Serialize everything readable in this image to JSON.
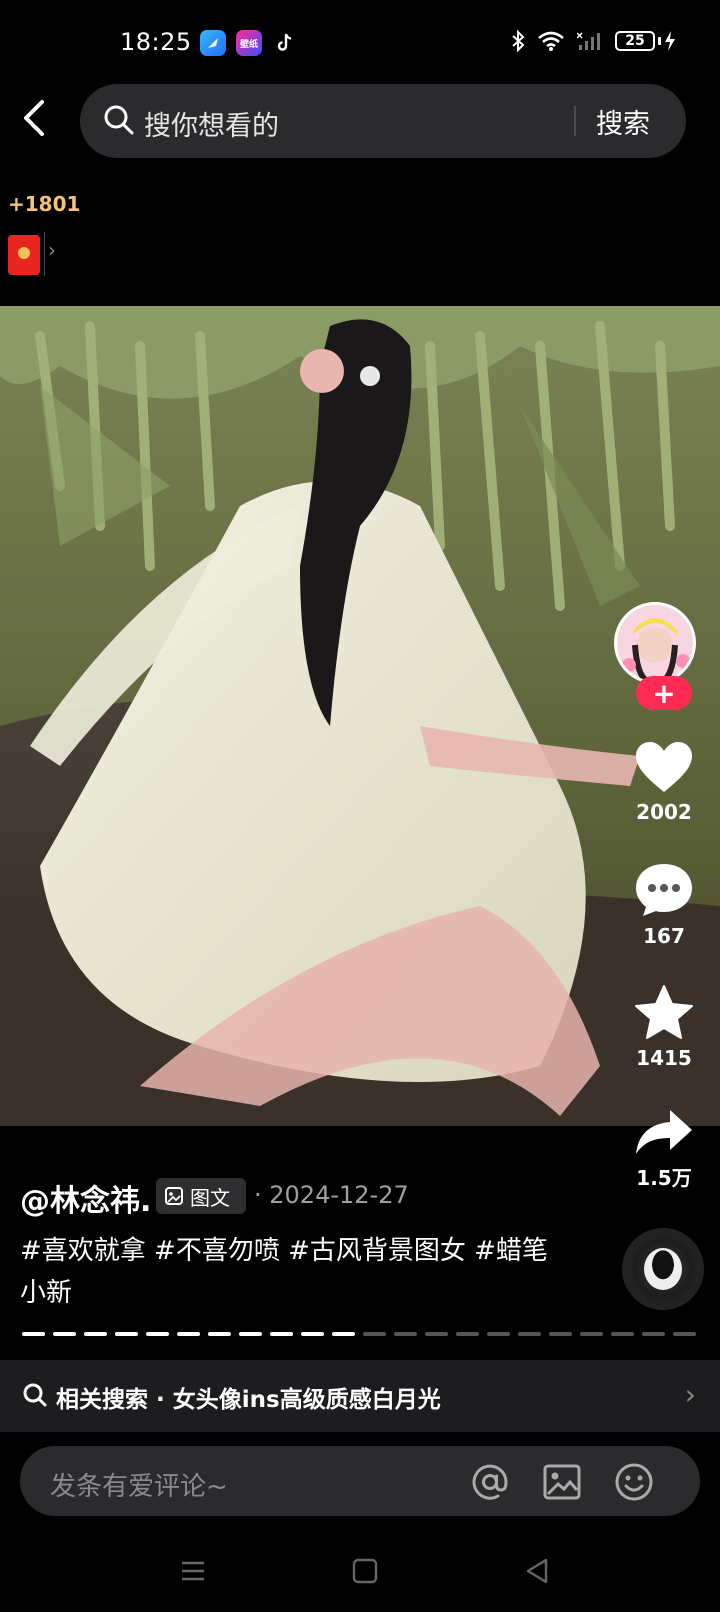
{
  "status_bar": {
    "time": "18:25",
    "app_icons": [
      "browser-app-icon",
      "wallpaper-app-icon",
      "tiktok-app-icon"
    ],
    "wallpaper_app_text": "壁纸",
    "battery": "25"
  },
  "header": {
    "search_placeholder": "搜你想看的",
    "search_button": "搜索"
  },
  "reward": {
    "count": "+1801"
  },
  "actions": {
    "likes": "2002",
    "comments": "167",
    "favorites": "1415",
    "shares": "1.5万"
  },
  "post": {
    "author": "@林念祎.",
    "type_badge": "图文",
    "date": "· 2024-12-27",
    "tags": "#喜欢就拿 #不喜勿喷 #古风背景图女 #蜡笔小新",
    "image_index": 11,
    "image_total": 22
  },
  "related": {
    "text": "相关搜索 · 女头像ins高级质感白月光"
  },
  "comment_bar": {
    "placeholder": "发条有爱评论~"
  },
  "colors": {
    "accent": "#fe2c55",
    "reward": "#f5c27a",
    "panel": "#2b2b2e"
  }
}
